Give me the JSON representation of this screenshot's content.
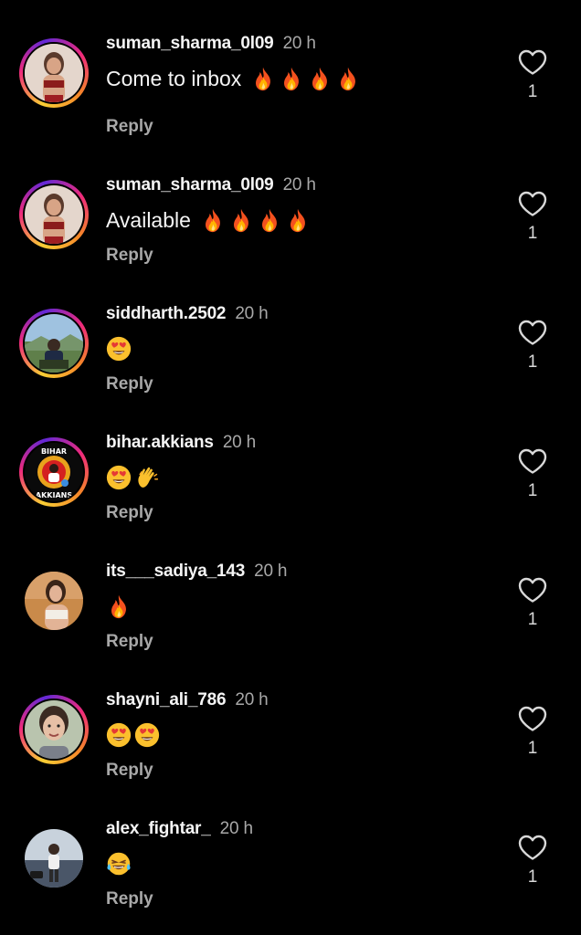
{
  "colors": {
    "background": "#000000",
    "text": "#f5f5f5",
    "muted": "#a8a8a8",
    "story_ring": "instagram-gradient"
  },
  "comments": [
    {
      "username": "suman_sharma_0l09",
      "time": "20 h",
      "text": "Come to inbox",
      "emojis": [
        "fire-emoji",
        "fire-emoji",
        "fire-emoji",
        "fire-emoji"
      ],
      "reply_label": "Reply",
      "likes": "1",
      "story_ring": true
    },
    {
      "username": "suman_sharma_0l09",
      "time": "20 h",
      "text": "Available",
      "emojis": [
        "fire-emoji",
        "fire-emoji",
        "fire-emoji",
        "fire-emoji"
      ],
      "reply_label": "Reply",
      "likes": "1",
      "story_ring": true
    },
    {
      "username": "siddharth.2502",
      "time": "20 h",
      "text": "",
      "emojis": [
        "heart-eyes-emoji"
      ],
      "reply_label": "Reply",
      "likes": "1",
      "story_ring": true
    },
    {
      "username": "bihar.akkians",
      "time": "20 h",
      "text": "",
      "emojis": [
        "heart-eyes-emoji",
        "clapping-hands-emoji"
      ],
      "reply_label": "Reply",
      "likes": "1",
      "story_ring": true,
      "avatar_text_top": "BIHAR",
      "avatar_text_bottom": "AKKIANS"
    },
    {
      "username": "its___sadiya_143",
      "time": "20 h",
      "text": "",
      "emojis": [
        "fire-emoji"
      ],
      "reply_label": "Reply",
      "likes": "1",
      "story_ring": false
    },
    {
      "username": "shayni_ali_786",
      "time": "20 h",
      "text": "",
      "emojis": [
        "heart-eyes-emoji",
        "heart-eyes-emoji"
      ],
      "reply_label": "Reply",
      "likes": "1",
      "story_ring": true
    },
    {
      "username": "alex_fightar_",
      "time": "20 h",
      "text": "",
      "emojis": [
        "tears-of-joy-emoji"
      ],
      "reply_label": "Reply",
      "likes": "1",
      "story_ring": false
    }
  ]
}
